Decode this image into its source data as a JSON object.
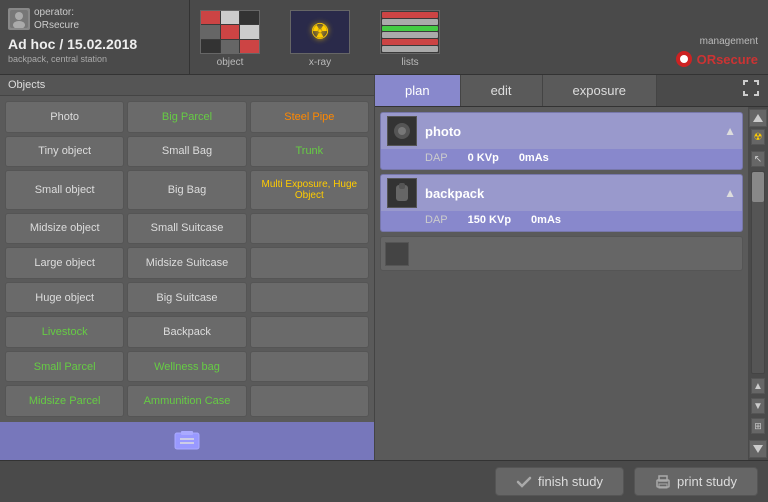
{
  "header": {
    "operator_label": "operator:",
    "operator_name": "ORsecure",
    "title": "Ad hoc / 15.02.2018",
    "station": "backpack, central station"
  },
  "nav": {
    "object_label": "object",
    "xray_label": "x-ray",
    "lists_label": "lists",
    "management_label": "management",
    "orsecure_label": "ORsecure"
  },
  "objects": {
    "header": "Objects",
    "buttons": [
      {
        "id": "photo",
        "label": "Photo",
        "color": "normal"
      },
      {
        "id": "big-parcel",
        "label": "Big Parcel",
        "color": "green"
      },
      {
        "id": "steel-pipe",
        "label": "Steel Pipe",
        "color": "orange"
      },
      {
        "id": "tiny-object",
        "label": "Tiny object",
        "color": "normal"
      },
      {
        "id": "small-bag",
        "label": "Small Bag",
        "color": "normal"
      },
      {
        "id": "trunk",
        "label": "Trunk",
        "color": "green"
      },
      {
        "id": "small-object",
        "label": "Small object",
        "color": "normal"
      },
      {
        "id": "big-bag",
        "label": "Big Bag",
        "color": "normal"
      },
      {
        "id": "multi-exposure",
        "label": "Multi Exposure, Huge Object",
        "color": "yellow"
      },
      {
        "id": "midsize-object",
        "label": "Midsize object",
        "color": "normal"
      },
      {
        "id": "small-suitcase",
        "label": "Small Suitcase",
        "color": "normal"
      },
      {
        "id": "empty1",
        "label": "",
        "color": "normal"
      },
      {
        "id": "large-object",
        "label": "Large object",
        "color": "normal"
      },
      {
        "id": "midsize-suitcase",
        "label": "Midsize Suitcase",
        "color": "normal"
      },
      {
        "id": "empty2",
        "label": "",
        "color": "normal"
      },
      {
        "id": "huge-object",
        "label": "Huge object",
        "color": "normal"
      },
      {
        "id": "big-suitcase",
        "label": "Big Suitcase",
        "color": "normal"
      },
      {
        "id": "empty3",
        "label": "",
        "color": "normal"
      },
      {
        "id": "livestock",
        "label": "Livestock",
        "color": "green"
      },
      {
        "id": "backpack",
        "label": "Backpack",
        "color": "normal"
      },
      {
        "id": "empty4",
        "label": "",
        "color": "normal"
      },
      {
        "id": "small-parcel",
        "label": "Small Parcel",
        "color": "green"
      },
      {
        "id": "wellness-bag",
        "label": "Wellness bag",
        "color": "green"
      },
      {
        "id": "empty5",
        "label": "",
        "color": "normal"
      },
      {
        "id": "midsize-parcel",
        "label": "Midsize Parcel",
        "color": "green"
      },
      {
        "id": "ammunition-case",
        "label": "Ammunition Case",
        "color": "green"
      },
      {
        "id": "empty6",
        "label": "",
        "color": "normal"
      }
    ]
  },
  "tabs": {
    "plan": "plan",
    "edit": "edit",
    "exposure": "exposure",
    "active": "plan"
  },
  "study_items": [
    {
      "id": "photo-item",
      "name": "photo",
      "dap_label": "DAP",
      "kvp_label": "KVp",
      "mas_label": "mAs",
      "kvp_value": "0 KVp",
      "mas_value": "0mAs",
      "dap_value": ""
    },
    {
      "id": "backpack-item",
      "name": "backpack",
      "dap_label": "DAP",
      "kvp_label": "KVp",
      "mas_label": "mAs",
      "kvp_value": "150 KVp",
      "mas_value": "0mAs",
      "dap_value": ""
    }
  ],
  "buttons": {
    "finish_study": "finish study",
    "print_study": "print study"
  }
}
